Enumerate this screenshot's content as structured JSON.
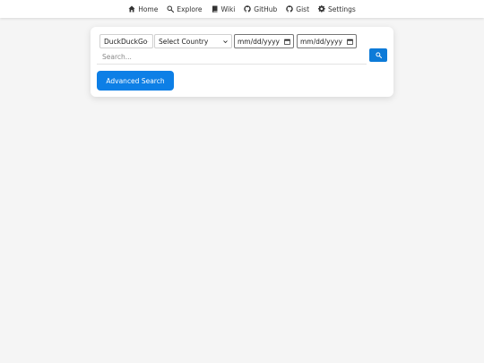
{
  "nav": {
    "items": [
      {
        "label": "Home",
        "icon": "home-icon"
      },
      {
        "label": "Explore",
        "icon": "search-icon"
      },
      {
        "label": "Wiki",
        "icon": "book-icon"
      },
      {
        "label": "GitHub",
        "icon": "github-icon"
      },
      {
        "label": "Gist",
        "icon": "github-icon"
      },
      {
        "label": "Settings",
        "icon": "gear-icon"
      }
    ]
  },
  "search": {
    "engine": "DuckDuckGo",
    "country": "Select Country",
    "date_from": "mm/dd/yyyy",
    "date_to": "mm/dd/yyyy",
    "placeholder": "Search...",
    "value": "",
    "advanced_label": "Advanced Search"
  },
  "colors": {
    "accent": "#0d7fe6",
    "background": "#f5f5f5",
    "card": "#ffffff"
  }
}
